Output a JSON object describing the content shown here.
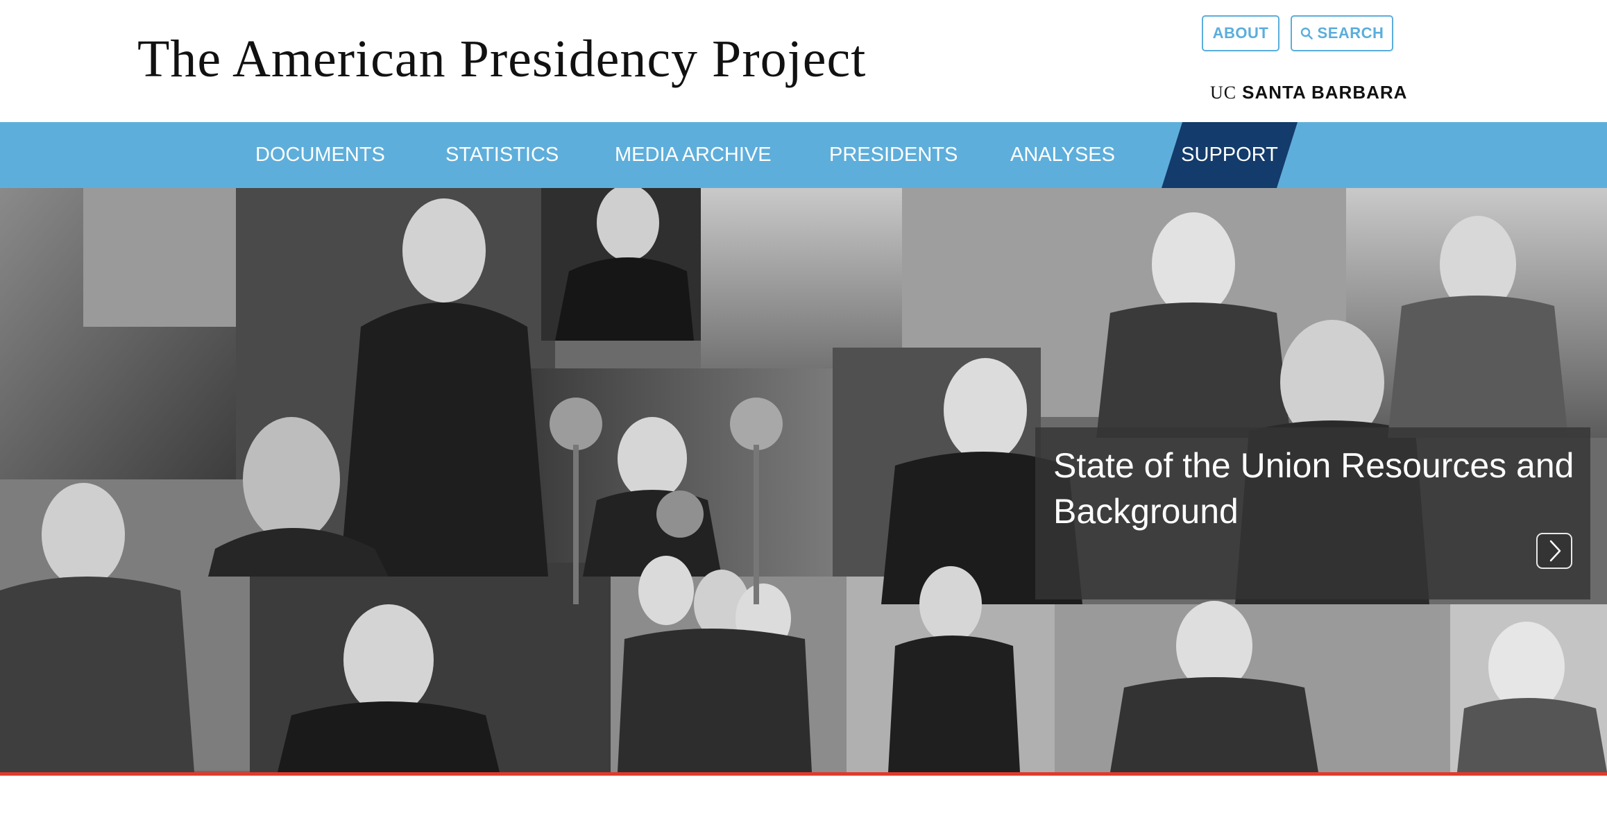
{
  "header": {
    "title": "The American Presidency Project",
    "about_label": "ABOUT",
    "search_label": "SEARCH",
    "search_icon": "magnifier",
    "university_prefix": "UC",
    "university_name": "SANTA BARBARA"
  },
  "nav": {
    "items": [
      "DOCUMENTS",
      "STATISTICS",
      "MEDIA ARCHIVE",
      "PRESIDENTS",
      "ANALYSES"
    ],
    "support_label": "SUPPORT"
  },
  "hero": {
    "caption": "State of the Union Resources and Background",
    "next_icon": "chevron-right"
  },
  "colors": {
    "nav_blue": "#5eaedb",
    "support_navy": "#133b6b",
    "button_blue": "#5aaedc",
    "accent_red": "#e03a2c",
    "caption_bg": "#343434"
  }
}
